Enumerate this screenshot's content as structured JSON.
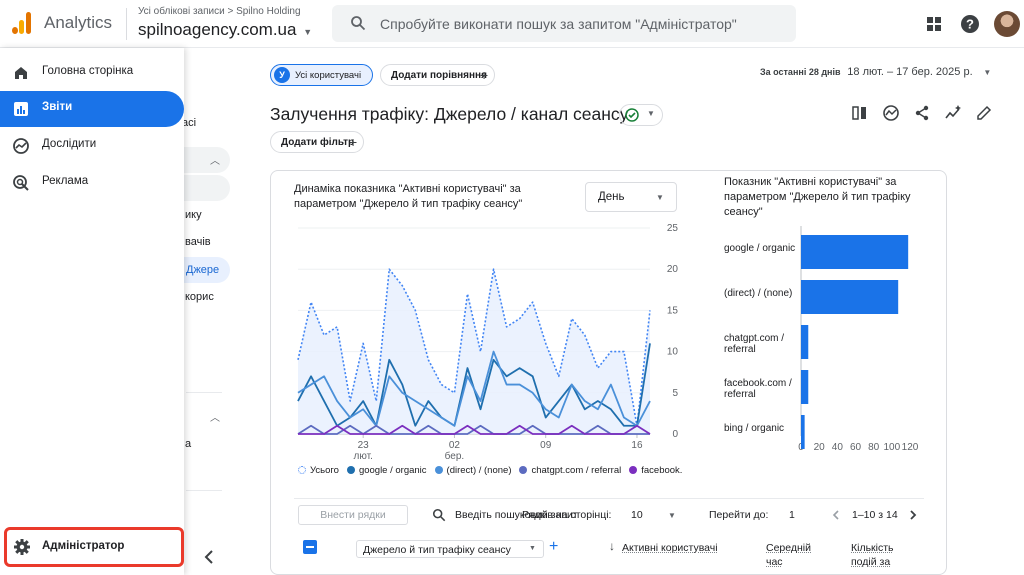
{
  "header": {
    "app_name": "Analytics",
    "breadcrumb": "Усі облікові записи > Spilno Holding",
    "property_name": "spilnoagency.com.ua",
    "search_placeholder": "Спробуйте виконати пошук за запитом \"Адміністратор\"",
    "brand_colors": [
      "#f9ab00",
      "#e37400"
    ]
  },
  "sidebar": {
    "items": [
      {
        "label": "Головна сторінка",
        "icon": "home-icon",
        "active": false
      },
      {
        "label": "Звіти",
        "icon": "reports-icon",
        "active": true
      },
      {
        "label": "Дослідити",
        "icon": "explore-icon",
        "active": false
      },
      {
        "label": "Реклама",
        "icon": "advertising-icon",
        "active": false
      }
    ],
    "admin_label": "Адміністратор",
    "admin_highlight_color": "#ea3a2b",
    "accent_color": "#1a73e8"
  },
  "subnav_peek": {
    "t1": "асі",
    "t2": "ику",
    "t3": "вачів",
    "t4": "Джере",
    "t5": "коpис",
    "t6": "а"
  },
  "filters": {
    "segment_badge": "У",
    "segment_label": "Усі користувачі",
    "add_comparison": "Додати порівняння",
    "date_prefix": "За останні 28 днів",
    "date_value": "18 лют. – 17 бер. 2025 р.",
    "add_filter": "Додати фільтр"
  },
  "page": {
    "title": "Залучення трафіку: Джерело / канал сеансу"
  },
  "line_chart": {
    "title": "Динаміка показника \"Активні користувачі\" за параметром \"Джерело й тип трафіку сеансу\"",
    "granularity": "День"
  },
  "bar_chart": {
    "title": "Показник \"Активні користувачі\" за параметром \"Джерело й тип трафіку сеансу\""
  },
  "chart_data": [
    {
      "type": "line",
      "ylim": [
        0,
        25
      ],
      "yticks": [
        0,
        5,
        10,
        15,
        20,
        25
      ],
      "xtick_labels": [
        {
          "day": "23",
          "month": "лют."
        },
        {
          "day": "02",
          "month": "бер."
        },
        {
          "day": "09",
          "month": ""
        },
        {
          "day": "16",
          "month": ""
        }
      ],
      "series": [
        {
          "name": "Усього",
          "color": "#4285f4",
          "style": "dotted-area",
          "values": [
            9,
            16,
            12,
            13,
            4,
            11,
            4,
            20,
            18,
            15,
            9,
            6,
            5,
            17,
            10,
            20,
            13,
            14,
            16,
            11,
            7,
            14,
            12,
            8,
            10,
            10,
            1,
            15
          ]
        },
        {
          "name": "google / organic",
          "color": "#1f6fae",
          "values": [
            4,
            7,
            4,
            1,
            2,
            4,
            1,
            9,
            6,
            1,
            4,
            2,
            1,
            8,
            3,
            9,
            7,
            8,
            7,
            2,
            4,
            6,
            3,
            4,
            3,
            1,
            1,
            11
          ]
        },
        {
          "name": "(direct) / (none)",
          "color": "#4a90d9",
          "values": [
            5,
            6,
            7,
            4,
            2,
            3,
            1,
            7,
            5,
            4,
            3,
            2,
            1,
            7,
            4,
            10,
            6,
            6,
            5,
            3,
            2,
            6,
            4,
            3,
            6,
            2,
            1,
            4
          ]
        },
        {
          "name": "chatgpt.com / referral",
          "color": "#5c6bc0",
          "values": [
            0,
            1,
            0,
            0,
            1,
            0,
            1,
            0,
            0,
            0,
            1,
            0,
            0,
            0,
            1,
            0,
            0,
            0,
            1,
            0,
            0,
            0,
            0,
            1,
            0,
            0,
            0,
            0
          ]
        },
        {
          "name": "facebook.",
          "color": "#7b2fbf",
          "values": [
            0,
            0,
            0,
            1,
            0,
            0,
            0,
            0,
            1,
            0,
            0,
            0,
            0,
            1,
            0,
            0,
            0,
            1,
            0,
            0,
            0,
            1,
            0,
            0,
            0,
            0,
            1,
            0
          ]
        }
      ]
    },
    {
      "type": "bar",
      "orientation": "horizontal",
      "categories": [
        "google / organic",
        "(direct) / (none)",
        "chatgpt.com / referral",
        "facebook.com / referral",
        "bing / organic"
      ],
      "values": [
        118,
        107,
        8,
        8,
        4
      ],
      "xlim": [
        0,
        120
      ],
      "xticks": [
        0,
        20,
        40,
        60,
        80,
        100,
        120
      ],
      "color": "#1a73e8"
    }
  ],
  "table": {
    "search_button": "Внести рядки",
    "search_placeholder": "Введіть пошуковий запит",
    "rows_per_page_label": "Рядків на сторінці:",
    "rows_per_page": "10",
    "goto_label": "Перейти до:",
    "goto_value": "1",
    "range": "1–10 з 14",
    "dimension": "Джерело й тип трафіку сеансу",
    "columns": [
      {
        "label": "Активні користувачі"
      },
      {
        "label": "Середній час"
      },
      {
        "label": "Кількість подій за"
      }
    ]
  }
}
